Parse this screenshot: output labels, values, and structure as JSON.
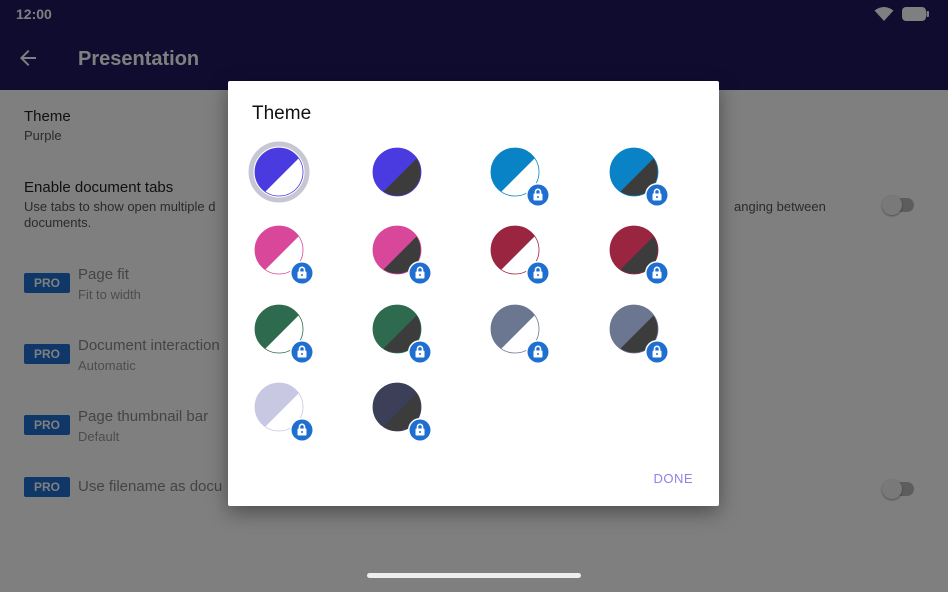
{
  "status_bar": {
    "time": "12:00",
    "icons": [
      "wifi-icon",
      "battery-icon"
    ]
  },
  "app_bar": {
    "title": "Presentation",
    "back_icon": "arrow-back-icon",
    "color": "#1e1860"
  },
  "settings": [
    {
      "title": "Theme",
      "subtitle": "Purple"
    },
    {
      "title": "Enable document tabs",
      "subtitle_left": "Use tabs to show open multiple d",
      "subtitle_right": "anging between",
      "subtitle_line2": "documents.",
      "toggle": false
    },
    {
      "badge": "PRO",
      "title": "Page fit",
      "subtitle": "Fit to width"
    },
    {
      "badge": "PRO",
      "title": "Document interaction",
      "subtitle": "Automatic"
    },
    {
      "badge": "PRO",
      "title": "Page thumbnail bar",
      "subtitle": "Default"
    },
    {
      "badge": "PRO",
      "title": "Use filename as docu",
      "toggle": false
    }
  ],
  "dialog": {
    "title": "Theme",
    "done_label": "DONE",
    "themes": [
      {
        "name": "purple-light",
        "color": "#4a3be0",
        "variant": "light",
        "selected": true,
        "locked": false
      },
      {
        "name": "purple-dark",
        "color": "#4a3be0",
        "variant": "dark",
        "locked": false
      },
      {
        "name": "blue-light",
        "color": "#0a82c6",
        "variant": "light",
        "locked": true
      },
      {
        "name": "blue-dark",
        "color": "#0a82c6",
        "variant": "dark",
        "locked": true
      },
      {
        "name": "pink-light",
        "color": "#d9479a",
        "variant": "light",
        "locked": true
      },
      {
        "name": "pink-dark",
        "color": "#d9479a",
        "variant": "dark",
        "locked": true
      },
      {
        "name": "crimson-light",
        "color": "#9a2540",
        "variant": "light",
        "locked": true
      },
      {
        "name": "crimson-dark",
        "color": "#9a2540",
        "variant": "dark",
        "locked": true
      },
      {
        "name": "green-light",
        "color": "#2e6b4e",
        "variant": "light",
        "locked": true
      },
      {
        "name": "green-dark",
        "color": "#2e6b4e",
        "variant": "dark",
        "locked": true
      },
      {
        "name": "slate-light",
        "color": "#6b7790",
        "variant": "light",
        "locked": true
      },
      {
        "name": "slate-dark",
        "color": "#6b7790",
        "variant": "dark",
        "locked": true
      },
      {
        "name": "lavender-light",
        "color": "#c8c8e2",
        "variant": "light",
        "locked": true
      },
      {
        "name": "navy-dark",
        "color": "#3b4058",
        "variant": "dark",
        "locked": true
      }
    ],
    "lock_badge_color": "#1f6fd1",
    "dark_half_color": "#3c3c3c"
  }
}
